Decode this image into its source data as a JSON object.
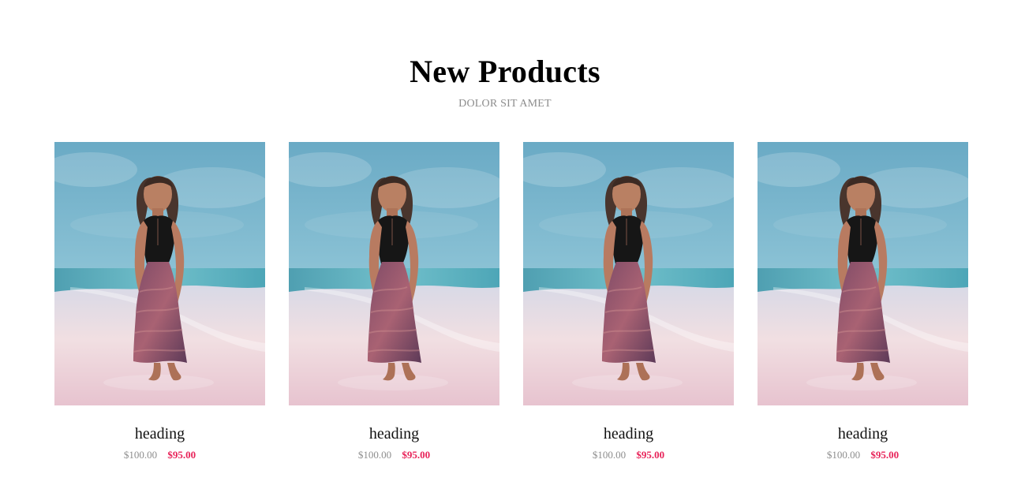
{
  "section": {
    "title": "New Products",
    "subtitle": "DOLOR SIT AMET"
  },
  "products": [
    {
      "name": "heading",
      "old_price": "$100.00",
      "new_price": "$95.00"
    },
    {
      "name": "heading",
      "old_price": "$100.00",
      "new_price": "$95.00"
    },
    {
      "name": "heading",
      "old_price": "$100.00",
      "new_price": "$95.00"
    },
    {
      "name": "heading",
      "old_price": "$100.00",
      "new_price": "$95.00"
    }
  ],
  "colors": {
    "title": "#000000",
    "subtitle": "#8c8c8c",
    "old_price": "#8d8d8d",
    "sale_price": "#e8245a",
    "sky": "#79b9cf",
    "sea": "#63b6c4",
    "sand": "#efdbe0"
  },
  "image_description_icon": "beach-woman-photo-icon"
}
